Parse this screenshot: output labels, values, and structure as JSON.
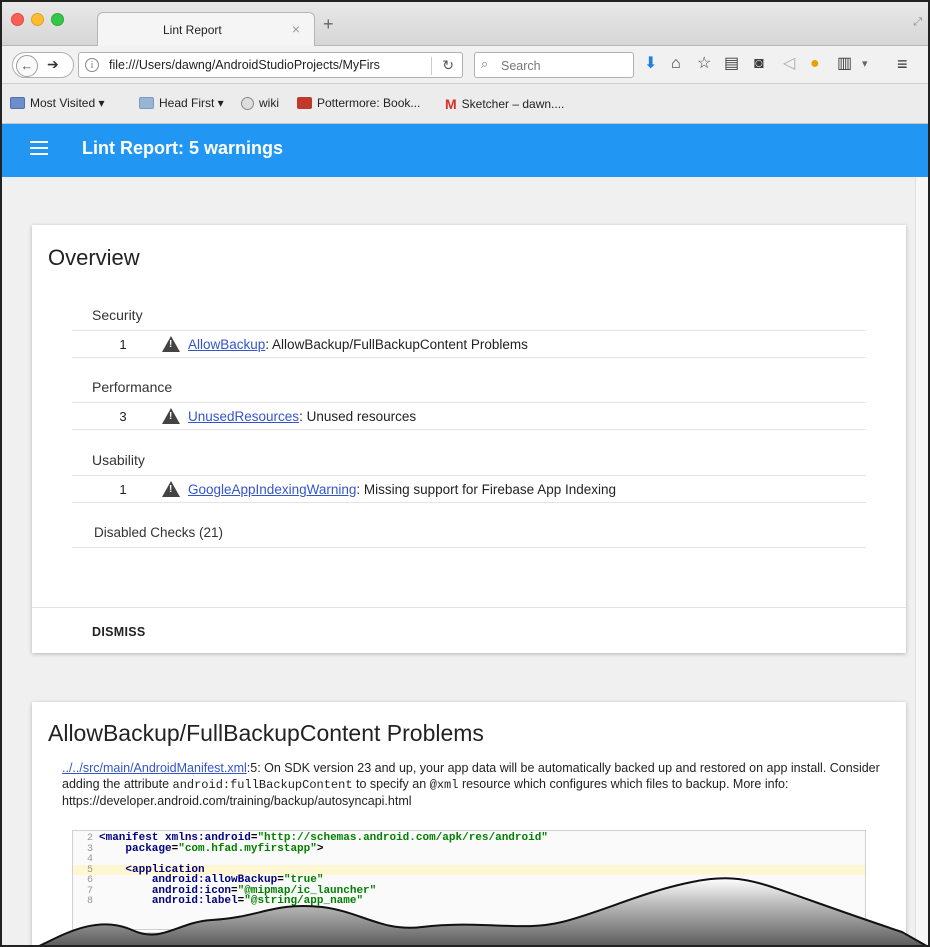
{
  "browser": {
    "tab_title": "Lint Report",
    "tab_close": "×",
    "new_tab": "+",
    "url": "file:///Users/dawng/AndroidStudioProjects/MyFirs",
    "search_placeholder": "Search",
    "bookmarks": [
      {
        "label": "Most Visited ▾",
        "icon": "most-visited-icon"
      },
      {
        "label": "Head First ▾",
        "icon": "folder-icon"
      },
      {
        "label": "wiki",
        "icon": "globe-icon"
      },
      {
        "label": "Pottermore: Book...",
        "icon": "pottermore-icon"
      },
      {
        "label": "Sketcher – dawn....",
        "icon": "gmail-icon"
      }
    ]
  },
  "appbar": {
    "title": "Lint Report: 5 warnings"
  },
  "overview": {
    "title": "Overview",
    "categories": [
      {
        "name": "Security",
        "count": "1",
        "link": "AllowBackup",
        "description": ": AllowBackup/FullBackupContent Problems"
      },
      {
        "name": "Performance",
        "count": "3",
        "link": "UnusedResources",
        "description": ": Unused resources"
      },
      {
        "name": "Usability",
        "count": "1",
        "link": "GoogleAppIndexingWarning",
        "description": ": Missing support for Firebase App Indexing"
      }
    ],
    "disabled_checks": "Disabled Checks (21)",
    "dismiss": "DISMISS"
  },
  "issue": {
    "title": "AllowBackup/FullBackupContent Problems",
    "file_link": "../../src/main/AndroidManifest.xml",
    "text_1": ":5: On SDK version 23 and up, your app data will be automatically backed up and restored on app install. Consider adding the attribute ",
    "code_1": "android:fullBackupContent",
    "text_2": " to specify an ",
    "code_2": "@xml",
    "text_3": " resource which configures which files to backup. More info: https://developer.android.com/training/backup/autosyncapi.html",
    "code_lines": [
      {
        "no": "2",
        "tag": "<manifest ",
        "attr": "xmlns:android",
        "eq": "=",
        "val": "\"http://schemas.android.com/apk/res/android\"",
        "rest": ""
      },
      {
        "no": "3",
        "tag": "    ",
        "attr": "package",
        "eq": "=",
        "val": "\"com.hfad.myfirstapp\"",
        "rest": ">"
      },
      {
        "no": "4",
        "tag": "",
        "attr": "",
        "eq": "",
        "val": "",
        "rest": ""
      },
      {
        "no": "5",
        "tag": "    <application",
        "attr": "",
        "eq": "",
        "val": "",
        "rest": ""
      },
      {
        "no": "6",
        "tag": "        ",
        "attr": "android:allowBackup",
        "eq": "=",
        "val": "\"true\"",
        "rest": ""
      },
      {
        "no": "7",
        "tag": "        ",
        "attr": "android:icon",
        "eq": "=",
        "val": "\"@mipmap/ic_launcher\"",
        "rest": ""
      },
      {
        "no": "8",
        "tag": "        ",
        "attr": "android:label",
        "eq": "=",
        "val": "\"@string/app_name\"",
        "rest": ""
      }
    ]
  },
  "colors": {
    "appbar": "#2196f3",
    "link": "#3355cc",
    "highlight_line": "#fff7d1"
  }
}
